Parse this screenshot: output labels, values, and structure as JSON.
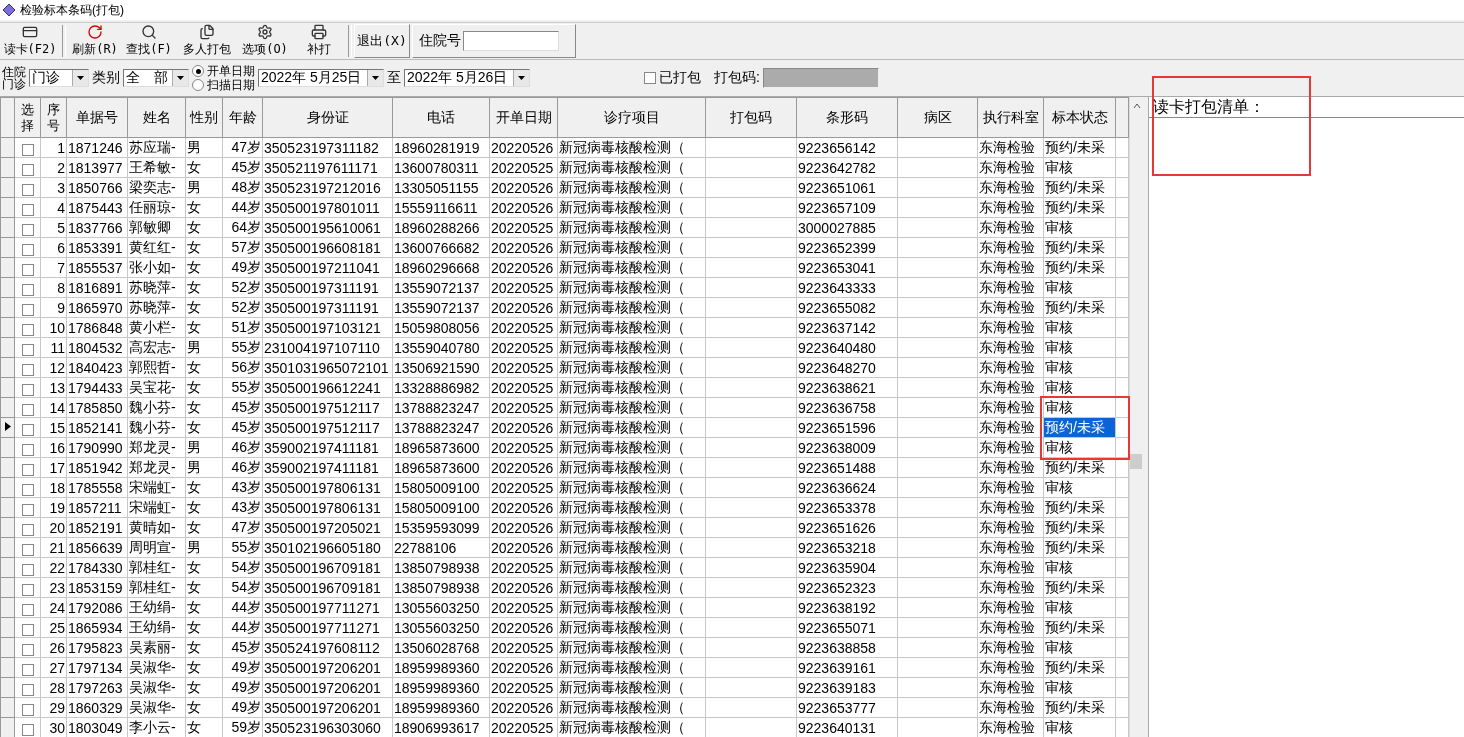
{
  "window": {
    "title": "检验标本条码(打包)"
  },
  "toolbar": {
    "buttons": [
      {
        "kind": "card",
        "label": "读卡(F2)"
      },
      {
        "kind": "refresh",
        "label": "刷新(R)"
      },
      {
        "kind": "search",
        "label": "查找(F)"
      },
      {
        "kind": "multi",
        "label": "多人打包"
      },
      {
        "kind": "options",
        "label": "选项(O)"
      },
      {
        "kind": "print",
        "label": "补打"
      }
    ],
    "exit_button": "退出(X)",
    "inpatient_label": "住院号"
  },
  "filters": {
    "source_label": "住院门诊",
    "source_value": "门诊",
    "category_label": "类别",
    "category_value": "全　部",
    "radios": [
      {
        "label": "开单日期",
        "selected": true
      },
      {
        "label": "扫描日期",
        "selected": false
      }
    ],
    "date_from": "2022年  5月25日",
    "to_label": "至",
    "date_to": "2022年  5月26日",
    "packed_label": "已打包",
    "packed_checked": false,
    "pack_code_label": "打包码:"
  },
  "table": {
    "columns": [
      "选择",
      "序号",
      "单据号",
      "姓名",
      "性别",
      "年龄",
      "身份证",
      "电话",
      "开单日期",
      "诊疗项目",
      "打包码",
      "条形码",
      "病区",
      "执行科室",
      "标本状态"
    ],
    "rows": [
      {
        "seq": "1",
        "bill": "1871246",
        "name": "苏应瑞-",
        "sex": "男",
        "age": "47岁",
        "id": "350523197311182",
        "phone": "18960281919",
        "date": "20220526",
        "item": "新冠病毒核酸检测（",
        "barcode": "9223656142",
        "dept": "东海检验",
        "status": "预约/未采",
        "checked": false,
        "current": false,
        "status_selected": false
      },
      {
        "seq": "2",
        "bill": "1813977",
        "name": "王希敏-",
        "sex": "女",
        "age": "45岁",
        "id": "350521197611171",
        "phone": "13600780311",
        "date": "20220525",
        "item": "新冠病毒核酸检测（",
        "barcode": "9223642782",
        "dept": "东海检验",
        "status": "审核",
        "checked": false,
        "current": false,
        "status_selected": false
      },
      {
        "seq": "3",
        "bill": "1850766",
        "name": "梁奕志-",
        "sex": "男",
        "age": "48岁",
        "id": "350523197212016",
        "phone": "13305051155",
        "date": "20220526",
        "item": "新冠病毒核酸检测（",
        "barcode": "9223651061",
        "dept": "东海检验",
        "status": "预约/未采",
        "checked": false,
        "current": false,
        "status_selected": false
      },
      {
        "seq": "4",
        "bill": "1875443",
        "name": "任丽琼-",
        "sex": "女",
        "age": "44岁",
        "id": "350500197801011",
        "phone": "15559116611",
        "date": "20220526",
        "item": "新冠病毒核酸检测（",
        "barcode": "9223657109",
        "dept": "东海检验",
        "status": "预约/未采",
        "checked": false,
        "current": false,
        "status_selected": false
      },
      {
        "seq": "5",
        "bill": "1837766",
        "name": "郭敏卿",
        "sex": "女",
        "age": "64岁",
        "id": "350500195610061",
        "phone": "18960288266",
        "date": "20220525",
        "item": "新冠病毒核酸检测（",
        "barcode": "3000027885",
        "dept": "东海检验",
        "status": "审核",
        "checked": false,
        "current": false,
        "status_selected": false
      },
      {
        "seq": "6",
        "bill": "1853391",
        "name": "黄红红-",
        "sex": "女",
        "age": "57岁",
        "id": "350500196608181",
        "phone": "13600766682",
        "date": "20220526",
        "item": "新冠病毒核酸检测（",
        "barcode": "9223652399",
        "dept": "东海检验",
        "status": "预约/未采",
        "checked": false,
        "current": false,
        "status_selected": false
      },
      {
        "seq": "7",
        "bill": "1855537",
        "name": "张小如-",
        "sex": "女",
        "age": "49岁",
        "id": "350500197211041",
        "phone": "18960296668",
        "date": "20220526",
        "item": "新冠病毒核酸检测（",
        "barcode": "9223653041",
        "dept": "东海检验",
        "status": "预约/未采",
        "checked": false,
        "current": false,
        "status_selected": false
      },
      {
        "seq": "8",
        "bill": "1816891",
        "name": "苏晓萍-",
        "sex": "女",
        "age": "52岁",
        "id": "350500197311191",
        "phone": "13559072137",
        "date": "20220525",
        "item": "新冠病毒核酸检测（",
        "barcode": "9223643333",
        "dept": "东海检验",
        "status": "审核",
        "checked": false,
        "current": false,
        "status_selected": false
      },
      {
        "seq": "9",
        "bill": "1865970",
        "name": "苏晓萍-",
        "sex": "女",
        "age": "52岁",
        "id": "350500197311191",
        "phone": "13559072137",
        "date": "20220526",
        "item": "新冠病毒核酸检测（",
        "barcode": "9223655082",
        "dept": "东海检验",
        "status": "预约/未采",
        "checked": false,
        "current": false,
        "status_selected": false
      },
      {
        "seq": "10",
        "bill": "1786848",
        "name": "黄小栏-",
        "sex": "女",
        "age": "51岁",
        "id": "350500197103121",
        "phone": "15059808056",
        "date": "20220525",
        "item": "新冠病毒核酸检测（",
        "barcode": "9223637142",
        "dept": "东海检验",
        "status": "审核",
        "checked": false,
        "current": false,
        "status_selected": false
      },
      {
        "seq": "11",
        "bill": "1804532",
        "name": "高宏志-",
        "sex": "男",
        "age": "55岁",
        "id": "231004197107110",
        "phone": "13559040780",
        "date": "20220525",
        "item": "新冠病毒核酸检测（",
        "barcode": "9223640480",
        "dept": "东海检验",
        "status": "审核",
        "checked": false,
        "current": false,
        "status_selected": false
      },
      {
        "seq": "12",
        "bill": "1840423",
        "name": "郭熙哲-",
        "sex": "女",
        "age": "56岁",
        "id": "3501031965072101",
        "phone": "13506921590",
        "date": "20220525",
        "item": "新冠病毒核酸检测（",
        "barcode": "9223648270",
        "dept": "东海检验",
        "status": "审核",
        "checked": false,
        "current": false,
        "status_selected": false
      },
      {
        "seq": "13",
        "bill": "1794433",
        "name": "吴宝花-",
        "sex": "女",
        "age": "55岁",
        "id": "350500196612241",
        "phone": "13328886982",
        "date": "20220525",
        "item": "新冠病毒核酸检测（",
        "barcode": "9223638621",
        "dept": "东海检验",
        "status": "审核",
        "checked": false,
        "current": false,
        "status_selected": false
      },
      {
        "seq": "14",
        "bill": "1785850",
        "name": "魏小芬-",
        "sex": "女",
        "age": "45岁",
        "id": "350500197512117",
        "phone": "13788823247",
        "date": "20220525",
        "item": "新冠病毒核酸检测（",
        "barcode": "9223636758",
        "dept": "东海检验",
        "status": "审核",
        "checked": false,
        "current": false,
        "status_selected": false
      },
      {
        "seq": "15",
        "bill": "1852141",
        "name": "魏小芬-",
        "sex": "女",
        "age": "45岁",
        "id": "350500197512117",
        "phone": "13788823247",
        "date": "20220526",
        "item": "新冠病毒核酸检测（",
        "barcode": "9223651596",
        "dept": "东海检验",
        "status": "预约/未采",
        "checked": false,
        "current": true,
        "status_selected": true
      },
      {
        "seq": "16",
        "bill": "1790990",
        "name": "郑龙灵-",
        "sex": "男",
        "age": "46岁",
        "id": "359002197411181",
        "phone": "18965873600",
        "date": "20220525",
        "item": "新冠病毒核酸检测（",
        "barcode": "9223638009",
        "dept": "东海检验",
        "status": "审核",
        "checked": false,
        "current": false,
        "status_selected": false
      },
      {
        "seq": "17",
        "bill": "1851942",
        "name": "郑龙灵-",
        "sex": "男",
        "age": "46岁",
        "id": "359002197411181",
        "phone": "18965873600",
        "date": "20220526",
        "item": "新冠病毒核酸检测（",
        "barcode": "9223651488",
        "dept": "东海检验",
        "status": "预约/未采",
        "checked": false,
        "current": false,
        "status_selected": false
      },
      {
        "seq": "18",
        "bill": "1785558",
        "name": "宋端虹-",
        "sex": "女",
        "age": "43岁",
        "id": "350500197806131",
        "phone": "15805009100",
        "date": "20220525",
        "item": "新冠病毒核酸检测（",
        "barcode": "9223636624",
        "dept": "东海检验",
        "status": "审核",
        "checked": false,
        "current": false,
        "status_selected": false
      },
      {
        "seq": "19",
        "bill": "1857211",
        "name": "宋端虹-",
        "sex": "女",
        "age": "43岁",
        "id": "350500197806131",
        "phone": "15805009100",
        "date": "20220526",
        "item": "新冠病毒核酸检测（",
        "barcode": "9223653378",
        "dept": "东海检验",
        "status": "预约/未采",
        "checked": false,
        "current": false,
        "status_selected": false
      },
      {
        "seq": "20",
        "bill": "1852191",
        "name": "黄晴如-",
        "sex": "女",
        "age": "47岁",
        "id": "350500197205021",
        "phone": "15359593099",
        "date": "20220526",
        "item": "新冠病毒核酸检测（",
        "barcode": "9223651626",
        "dept": "东海检验",
        "status": "预约/未采",
        "checked": false,
        "current": false,
        "status_selected": false
      },
      {
        "seq": "21",
        "bill": "1856639",
        "name": "周明宣-",
        "sex": "男",
        "age": "55岁",
        "id": "350102196605180",
        "phone": "22788106",
        "date": "20220526",
        "item": "新冠病毒核酸检测（",
        "barcode": "9223653218",
        "dept": "东海检验",
        "status": "预约/未采",
        "checked": false,
        "current": false,
        "status_selected": false
      },
      {
        "seq": "22",
        "bill": "1784330",
        "name": "郭桂红-",
        "sex": "女",
        "age": "54岁",
        "id": "350500196709181",
        "phone": "13850798938",
        "date": "20220525",
        "item": "新冠病毒核酸检测（",
        "barcode": "9223635904",
        "dept": "东海检验",
        "status": "审核",
        "checked": false,
        "current": false,
        "status_selected": false
      },
      {
        "seq": "23",
        "bill": "1853159",
        "name": "郭桂红-",
        "sex": "女",
        "age": "54岁",
        "id": "350500196709181",
        "phone": "13850798938",
        "date": "20220526",
        "item": "新冠病毒核酸检测（",
        "barcode": "9223652323",
        "dept": "东海检验",
        "status": "预约/未采",
        "checked": false,
        "current": false,
        "status_selected": false
      },
      {
        "seq": "24",
        "bill": "1792086",
        "name": "王幼绢-",
        "sex": "女",
        "age": "44岁",
        "id": "350500197711271",
        "phone": "13055603250",
        "date": "20220525",
        "item": "新冠病毒核酸检测（",
        "barcode": "9223638192",
        "dept": "东海检验",
        "status": "审核",
        "checked": false,
        "current": false,
        "status_selected": false
      },
      {
        "seq": "25",
        "bill": "1865934",
        "name": "王幼绢-",
        "sex": "女",
        "age": "44岁",
        "id": "350500197711271",
        "phone": "13055603250",
        "date": "20220526",
        "item": "新冠病毒核酸检测（",
        "barcode": "9223655071",
        "dept": "东海检验",
        "status": "预约/未采",
        "checked": false,
        "current": false,
        "status_selected": false
      },
      {
        "seq": "26",
        "bill": "1795823",
        "name": "吴素丽-",
        "sex": "女",
        "age": "45岁",
        "id": "350524197608112",
        "phone": "13506028768",
        "date": "20220525",
        "item": "新冠病毒核酸检测（",
        "barcode": "9223638858",
        "dept": "东海检验",
        "status": "审核",
        "checked": false,
        "current": false,
        "status_selected": false
      },
      {
        "seq": "27",
        "bill": "1797134",
        "name": "吴淑华-",
        "sex": "女",
        "age": "49岁",
        "id": "350500197206201",
        "phone": "18959989360",
        "date": "20220526",
        "item": "新冠病毒核酸检测（",
        "barcode": "9223639161",
        "dept": "东海检验",
        "status": "预约/未采",
        "checked": false,
        "current": false,
        "status_selected": false
      },
      {
        "seq": "28",
        "bill": "1797263",
        "name": "吴淑华-",
        "sex": "女",
        "age": "49岁",
        "id": "350500197206201",
        "phone": "18959989360",
        "date": "20220525",
        "item": "新冠病毒核酸检测（",
        "barcode": "9223639183",
        "dept": "东海检验",
        "status": "审核",
        "checked": false,
        "current": false,
        "status_selected": false
      },
      {
        "seq": "29",
        "bill": "1860329",
        "name": "吴淑华-",
        "sex": "女",
        "age": "49岁",
        "id": "350500197206201",
        "phone": "18959989360",
        "date": "20220526",
        "item": "新冠病毒核酸检测（",
        "barcode": "9223653777",
        "dept": "东海检验",
        "status": "预约/未采",
        "checked": false,
        "current": false,
        "status_selected": false
      },
      {
        "seq": "30",
        "bill": "1803049",
        "name": "李小云-",
        "sex": "女",
        "age": "59岁",
        "id": "350523196303060",
        "phone": "18906993617",
        "date": "20220525",
        "item": "新冠病毒核酸检测（",
        "barcode": "9223640131",
        "dept": "东海检验",
        "status": "审核",
        "checked": false,
        "current": false,
        "status_selected": false
      }
    ]
  },
  "pack_list": {
    "title": "读卡打包清单：",
    "framed": true
  },
  "status_frame": true
}
